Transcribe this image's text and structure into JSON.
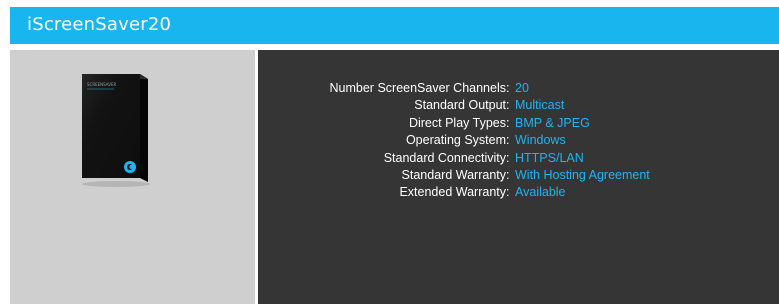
{
  "header": {
    "title": "iScreenSaver20"
  },
  "product": {
    "image": "product-box-icon",
    "brand_text": "SCREENSAVER"
  },
  "specs": [
    {
      "label": "Number ScreenSaver Channels",
      "value": "20"
    },
    {
      "label": "Standard Output",
      "value": "Multicast"
    },
    {
      "label": "Direct Play Types",
      "value": "BMP & JPEG"
    },
    {
      "label": "Operating System",
      "value": "Windows"
    },
    {
      "label": "Standard Connectivity",
      "value": "HTTPS/LAN"
    },
    {
      "label": "Standard Warranty",
      "value": "With Hosting Agreement"
    },
    {
      "label": "Extended Warranty",
      "value": "Available"
    }
  ],
  "colors": {
    "header_bg": "#19b5ee",
    "value_text": "#1fb4f0",
    "label_text": "#ffffff",
    "panel_dark": "#353535",
    "panel_light": "#cfcfcf"
  }
}
